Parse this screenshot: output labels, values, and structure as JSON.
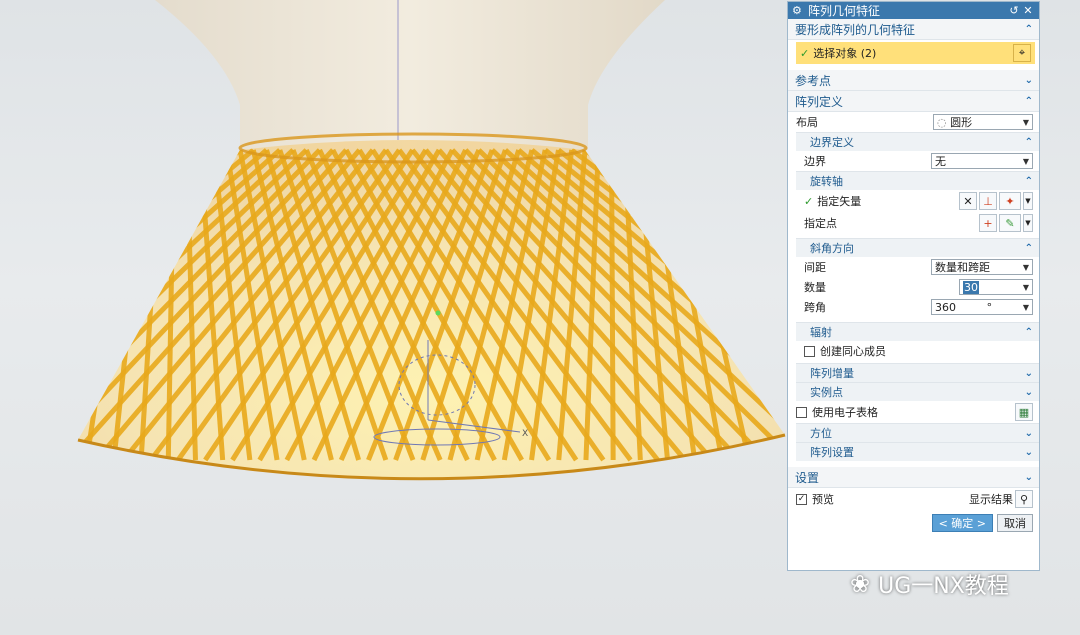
{
  "dialog": {
    "title": "阵列几何特征",
    "features_group": "要形成阵列的几何特征",
    "select_object": "选择对象 (2)",
    "reference_group": "参考点",
    "array_def_group": "阵列定义",
    "layout_label": "布局",
    "layout_value": "圆形",
    "boundary_group": "边界定义",
    "boundary_label": "边界",
    "boundary_value": "无",
    "rotation_axis_group": "旋转轴",
    "specify_vector": "指定矢量",
    "specify_point": "指定点",
    "angle_dir_group": "斜角方向",
    "spacing_label": "间距",
    "spacing_value": "数量和跨距",
    "count_label": "数量",
    "count_value": "30",
    "span_label": "跨角",
    "span_value": "360",
    "span_unit": "°",
    "radial_group": "辐射",
    "concentric_label": "创建同心成员",
    "increment_group": "阵列增量",
    "instance_group": "实例点",
    "spreadsheet_label": "使用电子表格",
    "orientation_group": "方位",
    "array_settings_group": "阵列设置",
    "settings_group": "设置",
    "preview_label": "预览",
    "show_result": "显示结果",
    "ok_button": "< 确定 >",
    "cancel_button": "取消"
  },
  "watermark": "UG一NX教程",
  "colors": {
    "title_bar": "#3b78ad",
    "highlight": "#ffe07a",
    "strip": "#e8a81c"
  }
}
